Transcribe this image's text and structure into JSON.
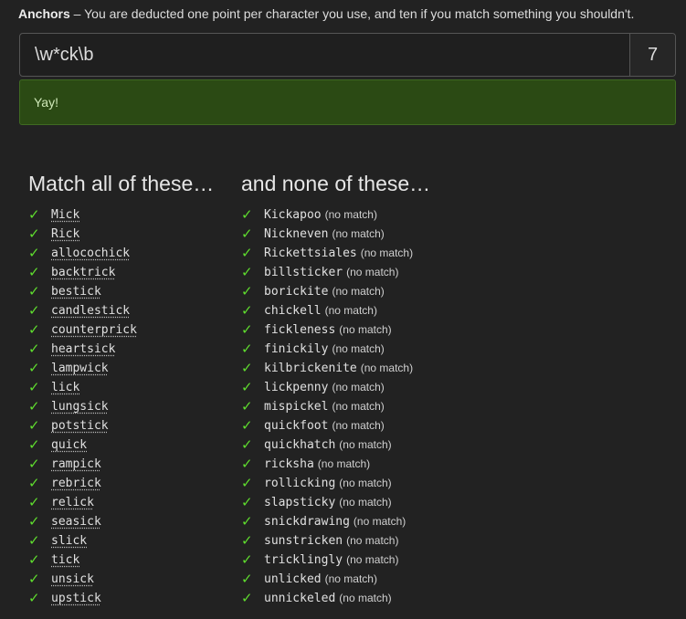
{
  "header": {
    "title": "Anchors",
    "description": " – You are deducted one point per character you use, and ten if you match something you shouldn't."
  },
  "regex": {
    "value": "\\w*ck\\b",
    "score": "7"
  },
  "result": {
    "message": "Yay!"
  },
  "match_column": {
    "heading": "Match all of these…",
    "check_icon": "✓",
    "check_color": "#5fdc2e",
    "items": [
      "Mick",
      "Rick",
      "allocochick",
      "backtrick",
      "bestick",
      "candlestick",
      "counterprick",
      "heartsick",
      "lampwick",
      "lick",
      "lungsick",
      "potstick",
      "quick",
      "rampick",
      "rebrick",
      "relick",
      "seasick",
      "slick",
      "tick",
      "unsick",
      "upstick"
    ]
  },
  "nonmatch_column": {
    "heading": "and none of these…",
    "check_icon": "✓",
    "no_match_label": "(no match)",
    "items": [
      "Kickapoo",
      "Nickneven",
      "Rickettsiales",
      "billsticker",
      "borickite",
      "chickell",
      "fickleness",
      "finickily",
      "kilbrickenite",
      "lickpenny",
      "mispickel",
      "quickfoot",
      "quickhatch",
      "ricksha",
      "rollicking",
      "slapsticky",
      "snickdrawing",
      "sunstricken",
      "tricklingly",
      "unlicked",
      "unnickeled"
    ]
  }
}
